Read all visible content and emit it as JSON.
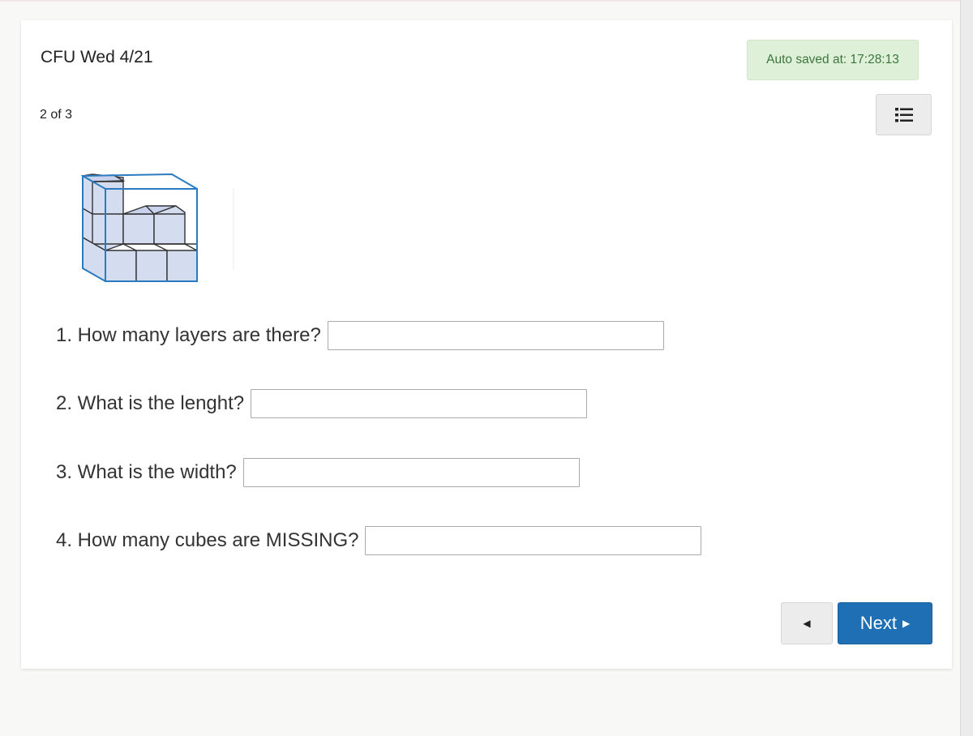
{
  "header": {
    "title": "CFU Wed 4/21",
    "autosave": "Auto saved at: 17:28:13",
    "progress": "2 of 3"
  },
  "toolbar": {
    "list_icon": "list-icon"
  },
  "questions": [
    {
      "label": "1. How many layers are there?",
      "value": ""
    },
    {
      "label": "2. What is the lenght?",
      "value": ""
    },
    {
      "label": "3. What is the width?",
      "value": ""
    },
    {
      "label": "4. How many cubes are MISSING?",
      "value": ""
    }
  ],
  "nav": {
    "prev_symbol": "◀",
    "next_label": "Next",
    "next_symbol": "▶"
  },
  "colors": {
    "primary": "#1f6fb5",
    "autosave_bg": "#dff0d8",
    "autosave_text": "#3c763d",
    "cube_fill": "#d4dcf0",
    "cube_outline": "#2a7bc0"
  }
}
